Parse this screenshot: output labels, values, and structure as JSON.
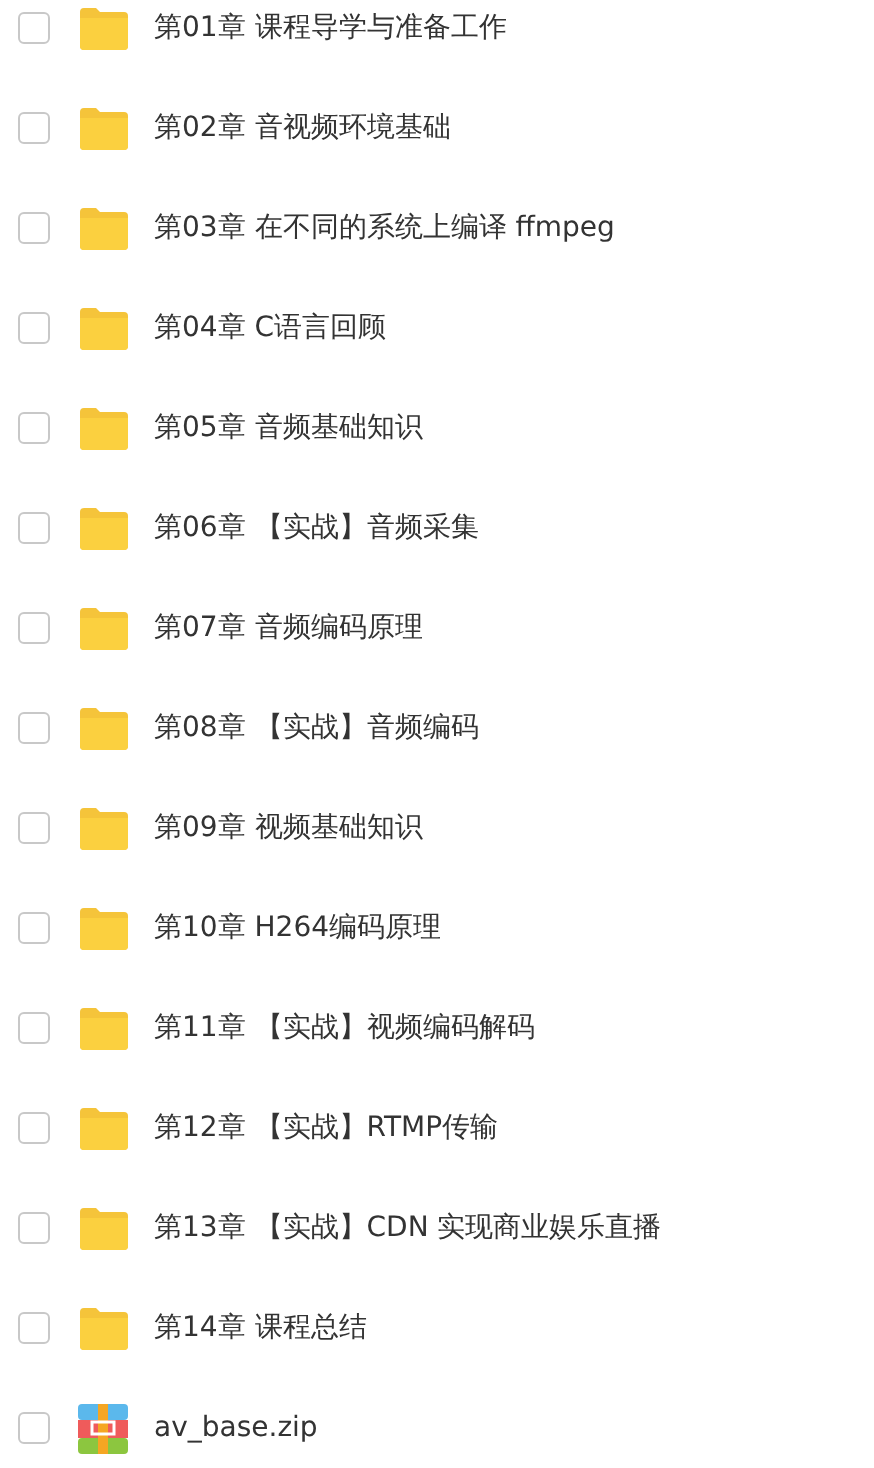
{
  "files": [
    {
      "kind": "folder",
      "name": "第01章 课程导学与准备工作",
      "checked": false
    },
    {
      "kind": "folder",
      "name": "第02章 音视频环境基础",
      "checked": false
    },
    {
      "kind": "folder",
      "name": "第03章 在不同的系统上编译 ffmpeg",
      "checked": false
    },
    {
      "kind": "folder",
      "name": "第04章 C语言回顾",
      "checked": false
    },
    {
      "kind": "folder",
      "name": "第05章 音频基础知识",
      "checked": false
    },
    {
      "kind": "folder",
      "name": "第06章 【实战】音频采集",
      "checked": false
    },
    {
      "kind": "folder",
      "name": "第07章 音频编码原理",
      "checked": false
    },
    {
      "kind": "folder",
      "name": "第08章 【实战】音频编码",
      "checked": false
    },
    {
      "kind": "folder",
      "name": "第09章 视频基础知识",
      "checked": false
    },
    {
      "kind": "folder",
      "name": "第10章 H264编码原理",
      "checked": false
    },
    {
      "kind": "folder",
      "name": "第11章 【实战】视频编码解码",
      "checked": false
    },
    {
      "kind": "folder",
      "name": "第12章 【实战】RTMP传输",
      "checked": false
    },
    {
      "kind": "folder",
      "name": "第13章 【实战】CDN 实现商业娱乐直播",
      "checked": false
    },
    {
      "kind": "folder",
      "name": "第14章 课程总结",
      "checked": false
    },
    {
      "kind": "archive",
      "name": "av_base.zip",
      "checked": false
    }
  ]
}
